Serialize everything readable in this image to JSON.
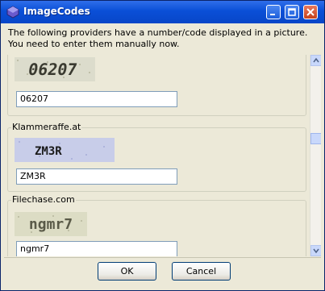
{
  "window": {
    "title": "ImageCodes",
    "message": "The following providers have a number/code displayed in a picture. You need to enter them manually now."
  },
  "providers": [
    {
      "name": "",
      "captcha_text": "06207",
      "input_value": "06207"
    },
    {
      "name": "Klammeraffe.at",
      "captcha_text": "ZM3R",
      "input_value": "ZM3R"
    },
    {
      "name": "Filechase.com",
      "captcha_text": "ngmr7",
      "input_value": "ngmr7"
    }
  ],
  "buttons": {
    "ok": "OK",
    "cancel": "Cancel"
  },
  "colors": {
    "title_bar": "#0a4fd7",
    "face": "#ece9d8",
    "scrollbar": "#c9d8fb"
  }
}
